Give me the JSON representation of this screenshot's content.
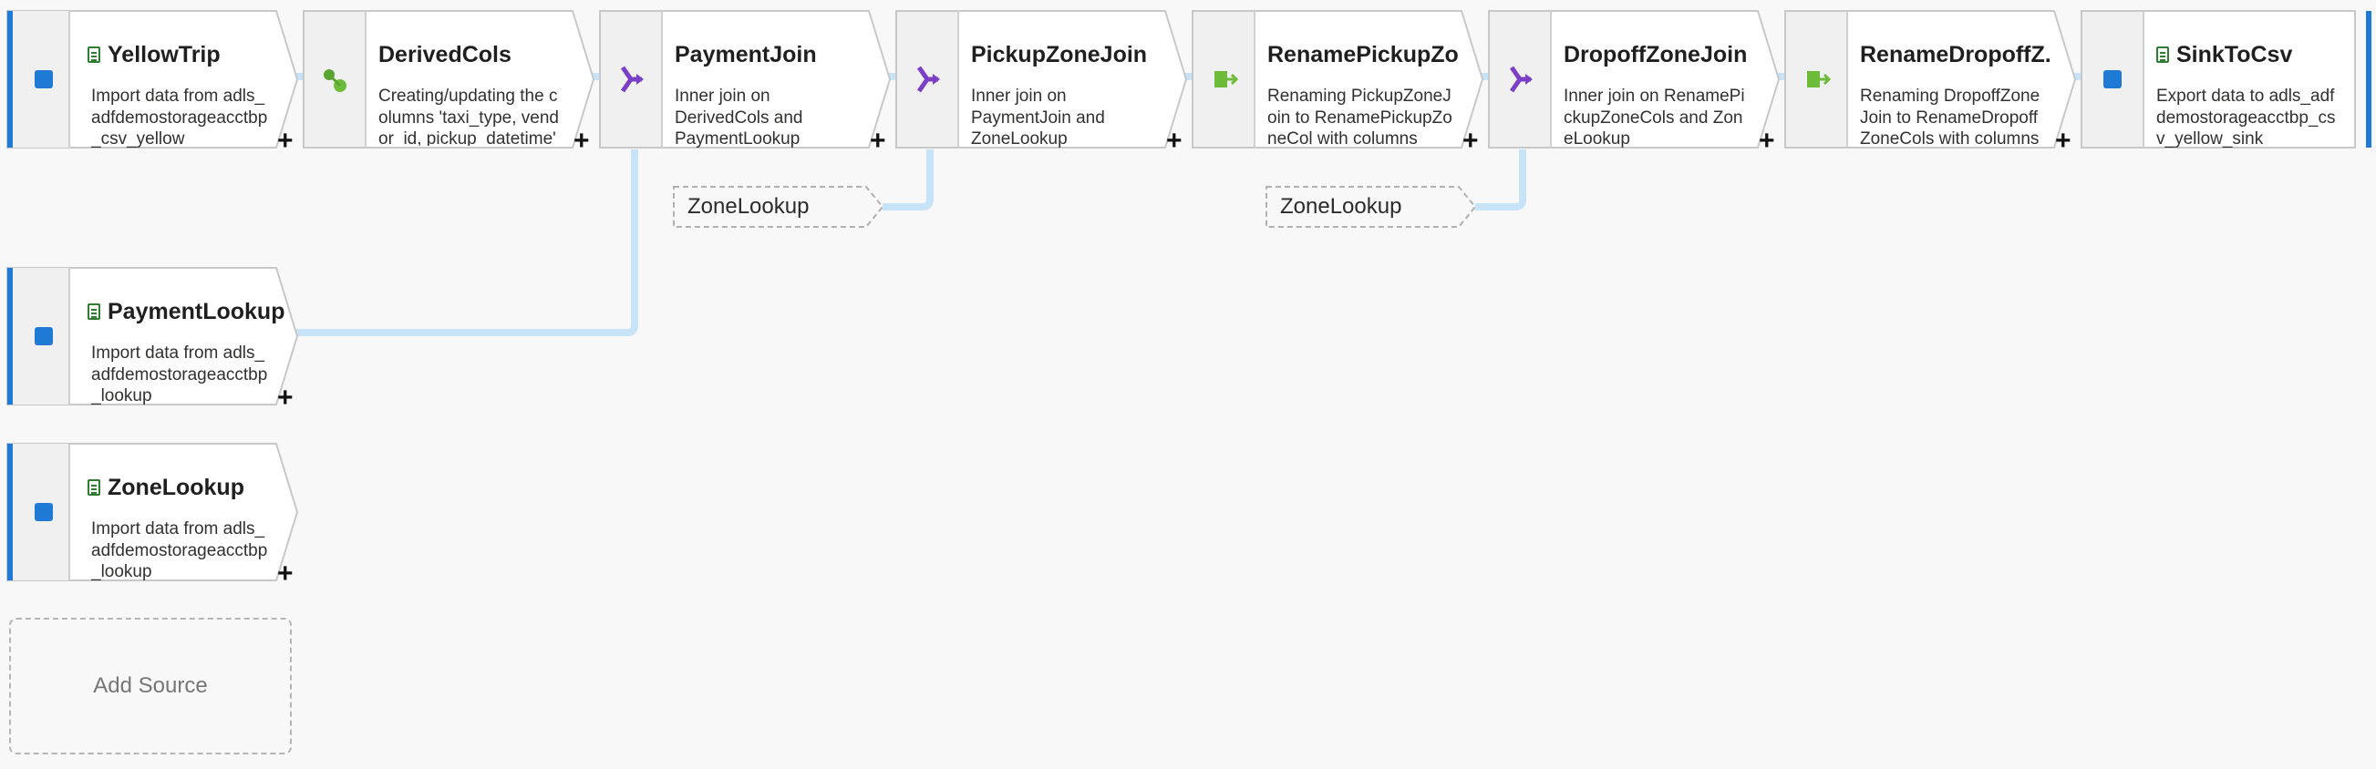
{
  "nodes": [
    {
      "id": "yellowtrip",
      "kind": "source",
      "title": "YellowTrip",
      "desc": "Import data from adls_adfdemostorageacctbp_csv_yellow",
      "doc_icon": true
    },
    {
      "id": "derivedcols",
      "kind": "derive",
      "title": "DerivedCols",
      "desc": "Creating/updating the columns 'taxi_type, vendor_id, pickup_datetime'",
      "doc_icon": false
    },
    {
      "id": "paymentjoin",
      "kind": "join",
      "title": "PaymentJoin",
      "desc": "Inner join on DerivedCols and PaymentLookup",
      "doc_icon": false
    },
    {
      "id": "pickupzonejoin",
      "kind": "join",
      "title": "PickupZoneJoin",
      "desc": "Inner join on PaymentJoin and ZoneLookup",
      "doc_icon": false
    },
    {
      "id": "renamepickupzonejoin",
      "kind": "select",
      "title": "RenamePickupZo...",
      "desc": "Renaming PickupZoneJoin to RenamePickupZoneCol with columns",
      "doc_icon": false
    },
    {
      "id": "dropoffzonejoin",
      "kind": "join",
      "title": "DropoffZoneJoin",
      "desc": "Inner join on RenamePickupZoneCols and ZoneLookup",
      "doc_icon": false
    },
    {
      "id": "renamedropoffzonejoin",
      "kind": "select",
      "title": "RenameDropoffZ...",
      "desc": "Renaming DropoffZoneJoin to RenameDropoffZoneCols with columns",
      "doc_icon": false
    },
    {
      "id": "sinktocsv",
      "kind": "sink",
      "title": "SinkToCsv",
      "desc": "Export data to adls_adfdemostorageacctbp_csv_yellow_sink",
      "doc_icon": true
    },
    {
      "id": "paymentlookup",
      "kind": "source",
      "title": "PaymentLookup",
      "desc": "Import data from adls_adfdemostorageacctbp_lookup",
      "doc_icon": true
    },
    {
      "id": "zonelookup",
      "kind": "source",
      "title": "ZoneLookup",
      "desc": "Import data from adls_adfdemostorageacctbp_lookup",
      "doc_icon": true
    }
  ],
  "references": [
    {
      "id": "ref-zonelookup-1",
      "label": "ZoneLookup"
    },
    {
      "id": "ref-zonelookup-2",
      "label": "ZoneLookup"
    }
  ],
  "add_source_label": "Add Source",
  "colors": {
    "accent_blue": "#1f7ad6",
    "link": "#c7e3f7",
    "node_fill": "#ffffff",
    "node_stripe": "#f0f0f0",
    "join_purple": "#7a3fc6",
    "select_green": "#6dbb3b"
  }
}
